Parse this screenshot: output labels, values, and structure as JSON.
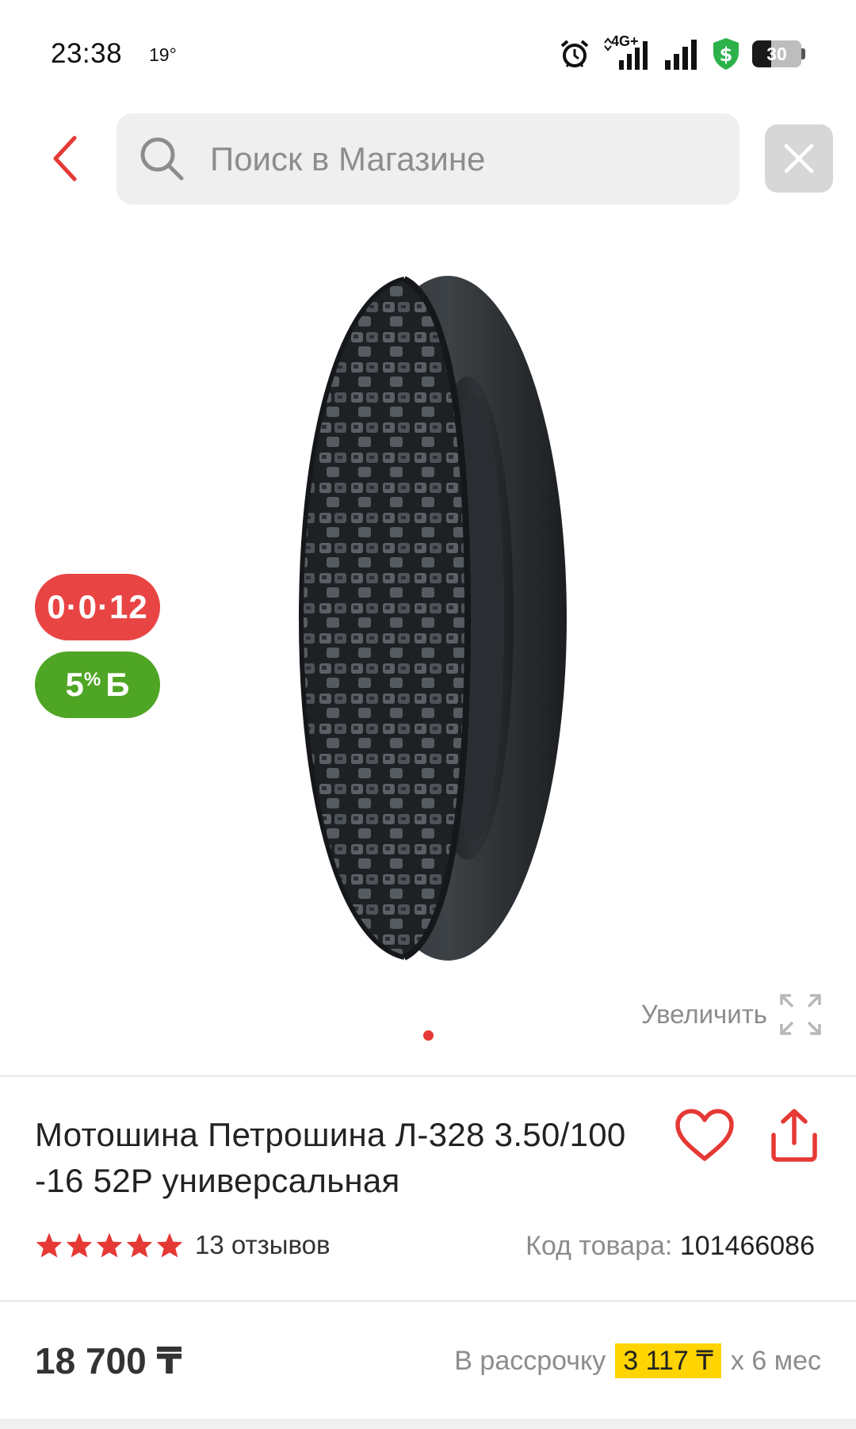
{
  "status_bar": {
    "time": "23:38",
    "temperature": "19°",
    "network_label": "4G+",
    "battery_level": "30",
    "icons": [
      "alarm-icon",
      "signal-4g-icon",
      "signal-icon",
      "security-shield-icon",
      "battery-icon"
    ]
  },
  "header": {
    "back_icon": "chevron-left-icon",
    "search_placeholder": "Поиск в Магазине",
    "clear_icon": "close-icon"
  },
  "gallery": {
    "badge_installment": "0·0·12",
    "badge_bonus_percent": "5",
    "badge_bonus_sup": "%",
    "badge_bonus_currency": "Б",
    "zoom_label": "Увеличить",
    "zoom_icon": "expand-icon",
    "image_count": 1,
    "current_image": 1
  },
  "product": {
    "title": "Мотошина Петрошина Л-328 3.50/100 -16 52P универсальная",
    "rating": 5,
    "reviews": "13 отзывов",
    "code_label": "Код товара:",
    "code_value": "101466086",
    "price": "18 700 ₸",
    "installment_prefix": "В рассрочку",
    "installment_amount": "3 117 ₸",
    "installment_suffix": "x 6 мес"
  },
  "colors": {
    "accent_red": "#e94444",
    "bonus_green": "#4fa524",
    "highlight_yellow": "#ffd400"
  }
}
